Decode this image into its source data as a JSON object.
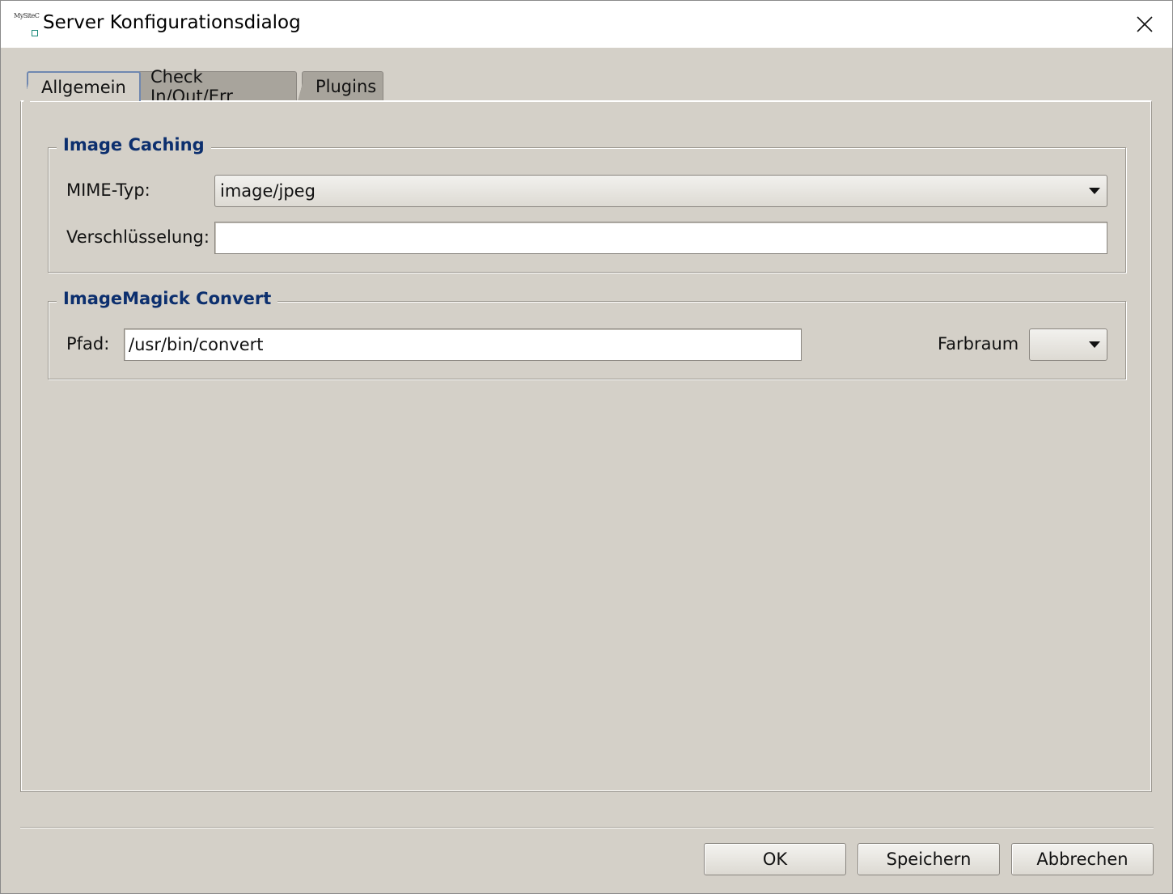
{
  "window": {
    "title": "Server Konfigurationsdialog",
    "icon_text": "MySiteC"
  },
  "tabs": [
    {
      "label": "Allgemein",
      "active": true
    },
    {
      "label": "Check In/Out/Err",
      "active": false
    },
    {
      "label": "Plugins",
      "active": false
    }
  ],
  "image_caching": {
    "title": "Image Caching",
    "mime_label": "MIME-Typ:",
    "mime_value": "image/jpeg",
    "encryption_label": "Verschlüsselung:",
    "encryption_value": ""
  },
  "imagemagick": {
    "title": "ImageMagick Convert",
    "path_label": "Pfad:",
    "path_value": "/usr/bin/convert",
    "colorspace_label": "Farbraum",
    "colorspace_value": ""
  },
  "buttons": {
    "ok": "OK",
    "save": "Speichern",
    "cancel": "Abbrechen"
  },
  "colors": {
    "dialog_background": "#d4d0c8",
    "group_title": "#0c2f6e",
    "active_tab_border": "#7088b0"
  }
}
